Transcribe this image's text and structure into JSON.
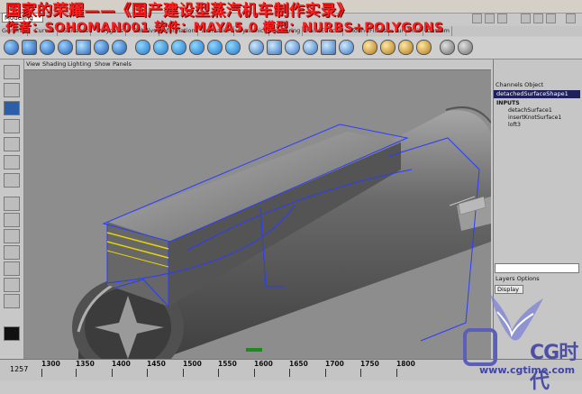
{
  "overlay": {
    "title_line": "国家的荣耀——《国产建设型蒸汽机车制作实录》",
    "credit_line": "作者：SOHOMAN001   软件：MAYA5.0   模型：NURBS+POLYGONS"
  },
  "mode_select": {
    "value": "Modeling"
  },
  "shelf": {
    "tabs": [
      "General",
      "Curves",
      "Surfaces",
      "Polygons",
      "Subdivs",
      "Deformation",
      "Animation",
      "Dynamics",
      "Rendering",
      "PaintEffects",
      "Toon",
      "Fluids",
      "Fur",
      "Hair",
      "Custom"
    ]
  },
  "viewport": {
    "menu": [
      "View",
      "Shading",
      "Lighting",
      "Show",
      "Panels"
    ]
  },
  "channel_box": {
    "header": "Channels  Object",
    "object_name": "detachedSurfaceShape1",
    "inputs_label": "INPUTS",
    "inputs": [
      "detachSurface1",
      "insertKnotSurface1",
      "loft3"
    ],
    "layers_header": "Layers  Options",
    "display_value": "Display"
  },
  "timeline": {
    "current_frame": "1257",
    "ticks": [
      "1300",
      "1350",
      "1400",
      "1450",
      "1500",
      "1550",
      "1600",
      "1650",
      "1700",
      "1750",
      "1800"
    ]
  },
  "watermark": {
    "logo_text": "CG时代",
    "url": "www.cgtime.com"
  },
  "colors": {
    "viewport_bg": "#8d8d8d",
    "overlay_text": "#ff1d1d",
    "selection_blue": "#2a3cff",
    "selection_yellow": "#e8d40a"
  }
}
